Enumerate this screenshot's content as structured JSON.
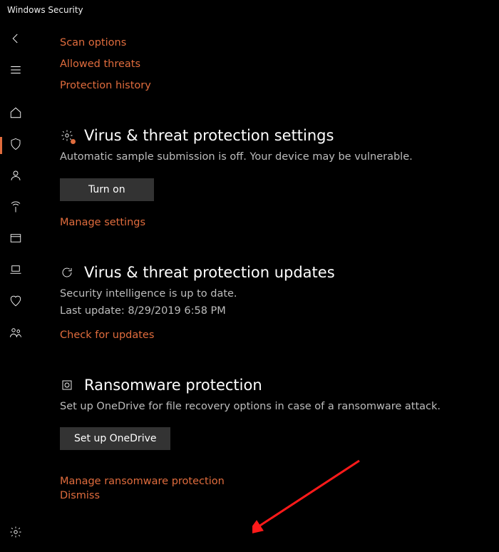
{
  "window": {
    "title": "Windows Security"
  },
  "top_links": {
    "scan_options": "Scan options",
    "allowed_threats": "Allowed threats",
    "protection_history": "Protection history"
  },
  "settings": {
    "heading": "Virus & threat protection settings",
    "desc": "Automatic sample submission is off. Your device may be vulnerable.",
    "turn_on": "Turn on",
    "manage": "Manage settings"
  },
  "updates": {
    "heading": "Virus & threat protection updates",
    "status": "Security intelligence is up to date.",
    "last_update": "Last update: 8/29/2019 6:58 PM",
    "check": "Check for updates"
  },
  "ransomware": {
    "heading": "Ransomware protection",
    "desc": "Set up OneDrive for file recovery options in case of a ransomware attack.",
    "setup": "Set up OneDrive",
    "manage": "Manage ransomware protection",
    "dismiss": "Dismiss"
  }
}
